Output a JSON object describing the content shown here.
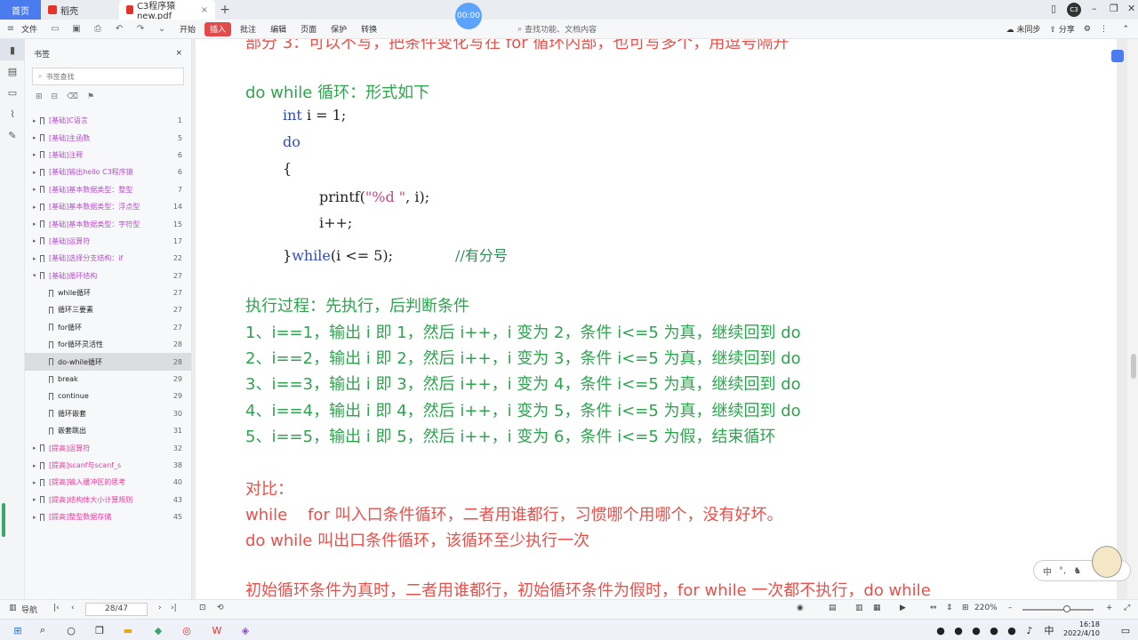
{
  "tabs": {
    "home": "首页",
    "wps": "稻壳",
    "doc": "C3程序猿new.pdf",
    "add": "+",
    "close": "×"
  },
  "timer": "00:00",
  "menubar": {
    "file": "文件",
    "items": [
      "开始",
      "插入",
      "批注",
      "编辑",
      "页面",
      "保护",
      "转换"
    ],
    "active_item": "插入",
    "search": "查找功能、文档内容",
    "sync": "未同步",
    "share": "分享"
  },
  "sidebar": {
    "title": "书签",
    "search_placeholder": "书签查找",
    "items": [
      {
        "label": "[基础]C语言",
        "page": "1"
      },
      {
        "label": "[基础]主函数",
        "page": "5"
      },
      {
        "label": "[基础]注释",
        "page": "6"
      },
      {
        "label": "[基础]输出hello C3程序猿",
        "page": "6"
      },
      {
        "label": "[基础]基本数据类型：整型",
        "page": "7"
      },
      {
        "label": "[基础]基本数据类型：浮点型",
        "page": "14"
      },
      {
        "label": "[基础]基本数据类型：字符型",
        "page": "15"
      },
      {
        "label": "[基础]运算符",
        "page": "17"
      },
      {
        "label": "[基础]选择分支结构：if",
        "page": "22"
      },
      {
        "label": "[基础]循环结构",
        "page": "27"
      },
      {
        "label": "while循环",
        "page": "27"
      },
      {
        "label": "循环三要素",
        "page": "27"
      },
      {
        "label": "for循环",
        "page": "27"
      },
      {
        "label": "for循环灵活性",
        "page": "28"
      },
      {
        "label": "do-while循环",
        "page": "28"
      },
      {
        "label": "break",
        "page": "29"
      },
      {
        "label": "continue",
        "page": "29"
      },
      {
        "label": "循环嵌套",
        "page": "30"
      },
      {
        "label": "嵌套跳出",
        "page": "31"
      },
      {
        "label": "[提高]运算符",
        "page": "32"
      },
      {
        "label": "[提高]scanf与scanf_s",
        "page": "38"
      },
      {
        "label": "[提高]输入缓冲区的思考",
        "page": "40"
      },
      {
        "label": "[提高]结构体大小计算规则",
        "page": "43"
      },
      {
        "label": "[提高]整型数据存储",
        "page": "45"
      }
    ]
  },
  "document": {
    "top_partial": "部分 3：可以不写，把条件变化写在 for 循环内部，也可写多个，用逗号隔开",
    "heading": "do while 循环：形式如下",
    "code": {
      "l1_kw": "int",
      "l1_rest": " i = 1;",
      "l2_kw": "do",
      "l3": "{",
      "l4_a": "printf(",
      "l4_str": "\"%d \"",
      "l4_b": ", i);",
      "l5": "i++;",
      "l6_a": "}",
      "l6_kw": "while",
      "l6_b": "(i <= 5);",
      "l6_cmt": "//有分号"
    },
    "exec_title": "执行过程：先执行，后判断条件",
    "steps": [
      "1、i==1，输出 i 即 1，然后 i++，i 变为 2，条件 i<=5 为真，继续回到 do",
      "2、i==2，输出 i 即 2，然后 i++，i 变为 3，条件 i<=5 为真，继续回到 do",
      "3、i==3，输出 i 即 3，然后 i++，i 变为 4，条件 i<=5 为真，继续回到 do",
      "4、i==4，输出 i 即 4，然后 i++，i 变为 5，条件 i<=5 为真，继续回到 do",
      "5、i==5，输出 i 即 5，然后 i++，i 变为 6，条件 i<=5 为假，结束循环"
    ],
    "compare_title": "对比：",
    "compare_1": "while    for 叫入口条件循环，二者用谁都行，习惯哪个用哪个，没有好坏。",
    "compare_2": "do while 叫出口条件循环，该循环至少执行一次",
    "bottom_partial": "初始循环条件为真时，二者用谁都行，初始循环条件为假时，for while 一次都不执行，do while"
  },
  "ime": {
    "lang": "中",
    "punct": "°,"
  },
  "status": {
    "nav": "导航",
    "page": "28/47",
    "zoom": "220%",
    "zoom_level": 0.62
  },
  "clock": {
    "time": "16:18",
    "date": "2022/4/10"
  },
  "colors": {
    "green_text": "#2ea44f",
    "red_text": "#e8504b",
    "keyword": "#2e4bc7",
    "accent": "#4a7cf0",
    "insert_tab": "#e34b4b"
  }
}
